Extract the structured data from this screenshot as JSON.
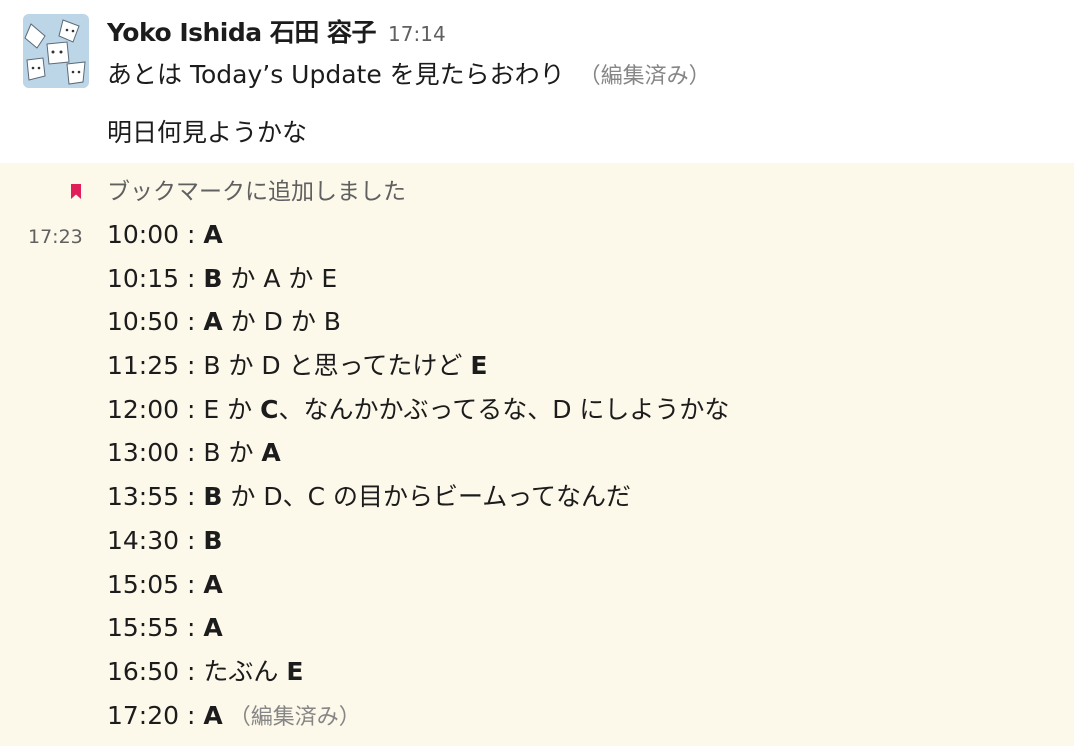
{
  "message1": {
    "sender": "Yoko Ishida 石田 容子",
    "timestamp": "17:14",
    "line1": "あとは Today’s Update を見たらおわり",
    "line1_edited": "（編集済み）",
    "line2": "明日何見ようかな"
  },
  "message2": {
    "bookmark_label": "ブックマークに追加しました",
    "bookmark_color": "#e01e5a",
    "background_color": "#fcf8ea",
    "hover_time": "17:23",
    "lines": [
      {
        "time": "10:00 : ",
        "parts": [
          {
            "text": "A",
            "bold": true
          }
        ]
      },
      {
        "time": "10:15 : ",
        "parts": [
          {
            "text": "B",
            "bold": true
          },
          {
            "text": " か A か E",
            "bold": false
          }
        ]
      },
      {
        "time": "10:50 : ",
        "parts": [
          {
            "text": "A",
            "bold": true
          },
          {
            "text": " か D か B",
            "bold": false
          }
        ]
      },
      {
        "time": "11:25 : ",
        "parts": [
          {
            "text": "B か D と思ってたけど ",
            "bold": false
          },
          {
            "text": "E",
            "bold": true
          }
        ]
      },
      {
        "time": "12:00 : ",
        "parts": [
          {
            "text": "E か ",
            "bold": false
          },
          {
            "text": "C",
            "bold": true
          },
          {
            "text": "、なんかかぶってるな、D にしようかな",
            "bold": false
          }
        ]
      },
      {
        "time": "13:00 : ",
        "parts": [
          {
            "text": "B か ",
            "bold": false
          },
          {
            "text": "A",
            "bold": true
          }
        ]
      },
      {
        "time": "13:55 : ",
        "parts": [
          {
            "text": "B",
            "bold": true
          },
          {
            "text": " か D、C の目からビームってなんだ",
            "bold": false
          }
        ]
      },
      {
        "time": "14:30 : ",
        "parts": [
          {
            "text": "B",
            "bold": true
          }
        ]
      },
      {
        "time": "15:05 : ",
        "parts": [
          {
            "text": "A",
            "bold": true
          }
        ]
      },
      {
        "time": "15:55 : ",
        "parts": [
          {
            "text": "A",
            "bold": true
          }
        ]
      },
      {
        "time": "16:50 : ",
        "parts": [
          {
            "text": "たぶん ",
            "bold": false
          },
          {
            "text": "E",
            "bold": true
          }
        ]
      },
      {
        "time": "17:20 : ",
        "parts": [
          {
            "text": "A",
            "bold": true
          }
        ],
        "edited": "（編集済み）"
      }
    ]
  }
}
